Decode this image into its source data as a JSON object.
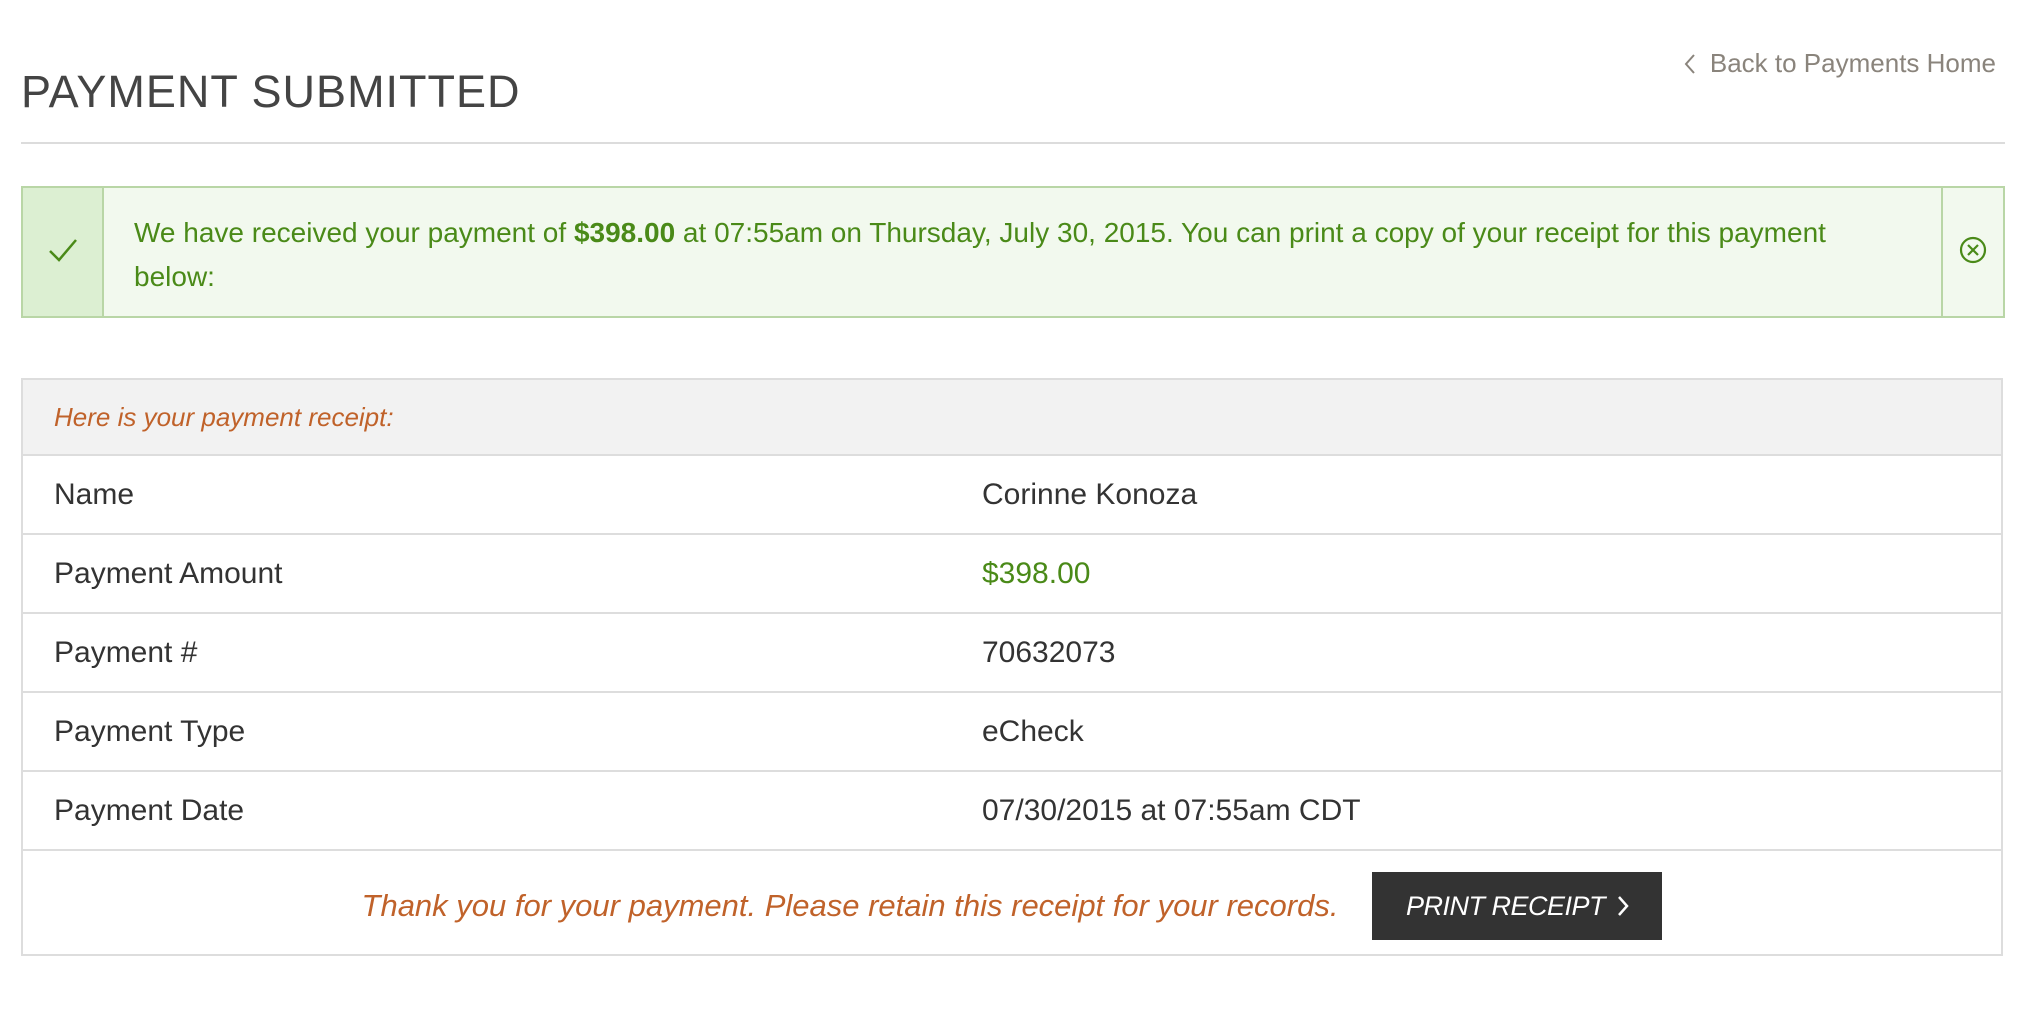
{
  "header": {
    "title": "PAYMENT SUBMITTED",
    "back_link_label": "Back to Payments Home",
    "back_icon": "chevron-left-icon"
  },
  "alert": {
    "icon": "checkmark-icon",
    "close_icon": "close-circle-icon",
    "text_before": "We have received your payment of ",
    "amount": "$398.00",
    "text_after": " at 07:55am on Thursday, July 30, 2015. You can print a copy of your receipt for this payment below:"
  },
  "receipt": {
    "header": "Here is your payment receipt:",
    "rows": [
      {
        "label": "Name",
        "value": "Corinne Konoza"
      },
      {
        "label": "Payment Amount",
        "value": "$398.00"
      },
      {
        "label": "Payment #",
        "value": "70632073"
      },
      {
        "label": "Payment Type",
        "value": "eCheck"
      },
      {
        "label": "Payment Date",
        "value": "07/30/2015 at 07:55am CDT"
      }
    ],
    "footer_note": "Thank you for your payment. Please retain this receipt for your records.",
    "print_button_label": "PRINT RECEIPT",
    "print_button_icon": "chevron-right-icon"
  },
  "colors": {
    "success_green": "#4a8a18",
    "accent_orange": "#c0622a",
    "button_dark": "#333333"
  }
}
